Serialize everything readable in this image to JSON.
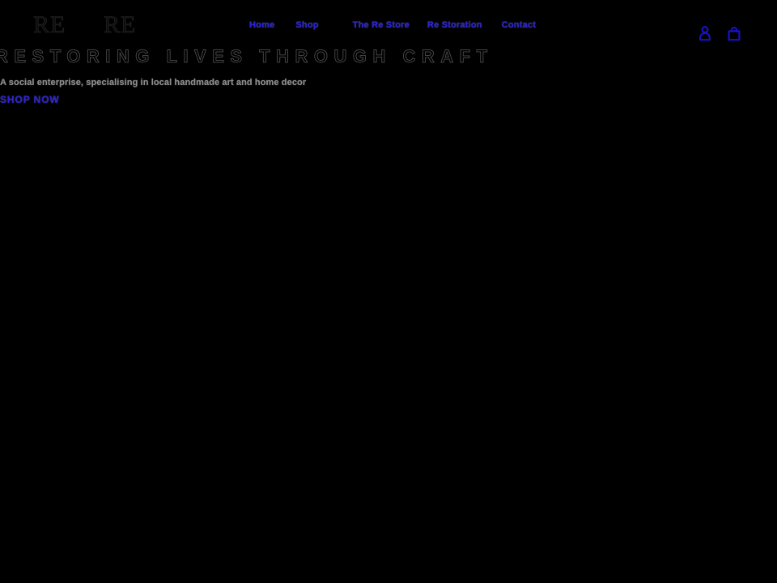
{
  "site": {
    "background_color": "#000000",
    "accent_color": "#2a22c8",
    "muted_text_color": "#8d8d8d"
  },
  "header": {
    "logo": {
      "primary_text": "RE",
      "secondary_text": "RE"
    },
    "nav": {
      "items": [
        {
          "label": "Home"
        },
        {
          "label": "Shop"
        },
        {
          "label": "The Re Store"
        },
        {
          "label": "Re Storation"
        },
        {
          "label": "Contact"
        }
      ]
    },
    "icons": [
      {
        "name": "account-icon",
        "label": "Account"
      },
      {
        "name": "shopping-bag-icon",
        "label": "Cart"
      }
    ]
  },
  "hero": {
    "title": "RESTORING LIVES THROUGH CRAFT",
    "subtitle": "A social enterprise, specialising in local handmade art and home decor",
    "cta_label": "SHOP NOW"
  }
}
